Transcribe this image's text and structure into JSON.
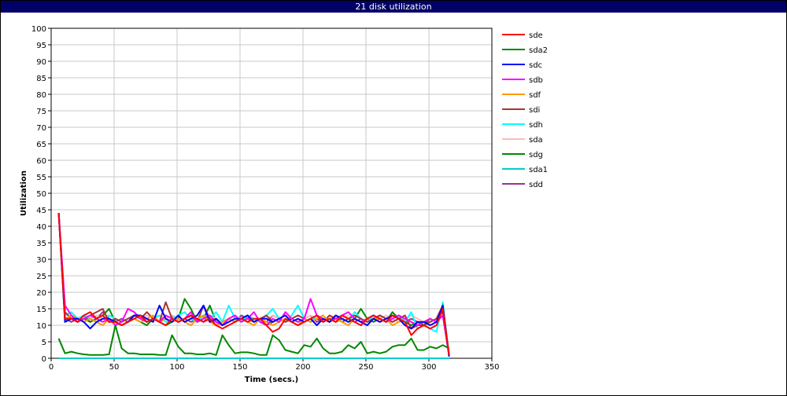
{
  "window": {
    "title": "21 disk utilization"
  },
  "chart_data": {
    "type": "line",
    "title": "21 disk utilization",
    "xlabel": "Time (secs.)",
    "ylabel": "Utilization",
    "xlim": [
      0,
      350
    ],
    "ylim": [
      0,
      100
    ],
    "xticks": [
      0,
      50,
      100,
      150,
      200,
      250,
      300,
      350
    ],
    "yticks": [
      0,
      5,
      10,
      15,
      20,
      25,
      30,
      35,
      40,
      45,
      50,
      55,
      60,
      65,
      70,
      75,
      80,
      85,
      90,
      95,
      100
    ],
    "grid": true,
    "legend": "right",
    "x": [
      6,
      11,
      16,
      21,
      26,
      31,
      36,
      41,
      46,
      51,
      56,
      61,
      66,
      71,
      76,
      81,
      86,
      91,
      96,
      101,
      106,
      111,
      116,
      121,
      126,
      131,
      136,
      141,
      146,
      151,
      156,
      161,
      166,
      171,
      176,
      181,
      186,
      191,
      196,
      201,
      206,
      211,
      216,
      221,
      226,
      231,
      236,
      241,
      246,
      251,
      256,
      261,
      266,
      271,
      276,
      281,
      286,
      291,
      296,
      301,
      306,
      311,
      316
    ],
    "series": [
      {
        "name": "sde",
        "color": "#ff0000",
        "values": [
          44,
          12,
          12,
          11,
          13,
          14,
          12,
          13,
          11,
          11,
          10,
          11,
          12,
          13,
          11,
          12,
          11,
          10,
          12,
          11,
          12,
          13,
          12,
          11,
          12,
          10,
          9,
          10,
          11,
          12,
          11,
          12,
          12,
          10,
          8,
          9,
          12,
          11,
          10,
          11,
          12,
          13,
          11,
          12,
          11,
          13,
          12,
          11,
          10,
          12,
          13,
          12,
          11,
          13,
          12,
          11,
          7,
          9,
          10,
          9,
          10,
          15,
          1
        ]
      },
      {
        "name": "sda2",
        "color": "#008800",
        "values": [
          6,
          1.5,
          2,
          1.5,
          1.2,
          1,
          1,
          1,
          1.2,
          10,
          3,
          1.5,
          1.5,
          1.2,
          1.2,
          1.2,
          1,
          1,
          7,
          3.5,
          1.5,
          1.5,
          1.2,
          1.2,
          1.5,
          1,
          7,
          4,
          1.5,
          1.8,
          1.8,
          1.5,
          1,
          1,
          7,
          5.5,
          2.5,
          2,
          1.5,
          4,
          3.5,
          6,
          3,
          1.5,
          1.5,
          2,
          4,
          3,
          5,
          1.5,
          2,
          1.5,
          2,
          3.5,
          4,
          4,
          6,
          2.5,
          2.5,
          3.5,
          3,
          4,
          3
        ]
      },
      {
        "name": "sdc",
        "color": "#0000ff",
        "values": [
          44,
          11,
          12,
          12,
          11,
          9,
          11,
          12,
          12,
          11,
          10,
          11,
          13,
          13,
          12,
          11,
          16,
          12,
          11,
          13,
          11,
          12,
          13,
          16,
          11,
          12,
          10,
          11,
          12,
          12,
          13,
          11,
          12,
          12,
          11,
          12,
          13,
          11,
          12,
          11,
          12,
          10,
          12,
          11,
          13,
          12,
          11,
          12,
          11,
          10,
          12,
          11,
          12,
          13,
          12,
          10,
          9,
          11,
          11,
          10,
          11,
          16,
          0.5
        ]
      },
      {
        "name": "sdb",
        "color": "#ff00ff",
        "values": [
          44,
          16,
          13,
          11,
          12,
          13,
          12,
          11,
          12,
          10,
          11,
          15,
          14,
          12,
          11,
          12,
          11,
          13,
          12,
          11,
          12,
          14,
          11,
          12,
          13,
          11,
          10,
          12,
          13,
          11,
          12,
          14,
          11,
          10,
          12,
          11,
          14,
          12,
          11,
          12,
          18,
          13,
          12,
          11,
          12,
          13,
          14,
          12,
          11,
          12,
          13,
          12,
          11,
          12,
          13,
          12,
          11,
          10,
          11,
          12,
          11,
          13,
          1
        ]
      },
      {
        "name": "sdf",
        "color": "#ff9900",
        "values": [
          44,
          12,
          13,
          12,
          11,
          12,
          11,
          10,
          12,
          11,
          10,
          11,
          12,
          11,
          12,
          13,
          11,
          12,
          11,
          12,
          11,
          10,
          12,
          13,
          11,
          10,
          11,
          12,
          11,
          12,
          11,
          10,
          12,
          11,
          10,
          11,
          12,
          11,
          10,
          12,
          11,
          12,
          13,
          11,
          12,
          11,
          10,
          12,
          11,
          12,
          13,
          11,
          12,
          10,
          11,
          12,
          11,
          10,
          11,
          12,
          11,
          16,
          1
        ]
      },
      {
        "name": "sdi",
        "color": "#aa3333",
        "values": [
          44,
          14,
          12,
          11,
          12,
          13,
          14,
          15,
          11,
          12,
          11,
          12,
          13,
          12,
          14,
          12,
          11,
          17,
          12,
          11,
          12,
          13,
          11,
          16,
          12,
          11,
          10,
          12,
          11,
          12,
          13,
          11,
          12,
          13,
          11,
          12,
          11,
          12,
          13,
          12,
          11,
          12,
          11,
          13,
          12,
          11,
          12,
          13,
          12,
          11,
          12,
          13,
          12,
          11,
          12,
          13,
          9,
          10,
          10,
          11,
          12,
          16,
          1
        ]
      },
      {
        "name": "sdh",
        "color": "#00ffff",
        "values": [
          44,
          13,
          14,
          12,
          13,
          12,
          11,
          12,
          13,
          12,
          11,
          12,
          13,
          12,
          11,
          12,
          13,
          11,
          12,
          13,
          14,
          12,
          11,
          13,
          12,
          14,
          11,
          16,
          12,
          11,
          13,
          12,
          11,
          13,
          15,
          12,
          11,
          13,
          16,
          12,
          11,
          13,
          12,
          11,
          13,
          12,
          11,
          14,
          12,
          11,
          13,
          12,
          11,
          12,
          13,
          11,
          14,
          9,
          10,
          9,
          8,
          17,
          1
        ]
      },
      {
        "name": "sda",
        "color": "#ffbbbb",
        "values": [
          44,
          12,
          13,
          12,
          13,
          12,
          13,
          12,
          13,
          12,
          11,
          12,
          13,
          12,
          13,
          12,
          13,
          12,
          13,
          12,
          11,
          12,
          13,
          12,
          13,
          12,
          11,
          12,
          13,
          12,
          13,
          12,
          11,
          12,
          13,
          12,
          13,
          12,
          11,
          12,
          13,
          12,
          11,
          12,
          13,
          12,
          13,
          12,
          11,
          12,
          13,
          12,
          13,
          12,
          11,
          12,
          13,
          12,
          11,
          12,
          11,
          13,
          1
        ]
      },
      {
        "name": "sdg",
        "color": "#008800",
        "values": [
          44,
          11,
          12,
          11,
          12,
          11,
          12,
          13,
          15,
          11,
          10,
          11,
          12,
          11,
          10,
          12,
          11,
          10,
          11,
          12,
          18,
          15,
          11,
          12,
          16,
          11,
          10,
          12,
          11,
          12,
          11,
          12,
          11,
          10,
          11,
          12,
          11,
          12,
          11,
          12,
          11,
          12,
          11,
          12,
          11,
          12,
          11,
          12,
          15,
          12,
          11,
          12,
          11,
          14,
          12,
          11,
          10,
          11,
          10,
          12,
          11,
          13,
          1
        ]
      },
      {
        "name": "sda1",
        "color": "#00cccc",
        "values": [
          0,
          0,
          0,
          0,
          0,
          0,
          0,
          0,
          0,
          0,
          0,
          0,
          0,
          0,
          0,
          0,
          0,
          0,
          0,
          0,
          0,
          0,
          0,
          0,
          0,
          0,
          0,
          0,
          0,
          0,
          0,
          0,
          0,
          0,
          0,
          0,
          0,
          0,
          0,
          0,
          0,
          0,
          0,
          0,
          0,
          0,
          0,
          0,
          0,
          0,
          0,
          0,
          0,
          0,
          0,
          0,
          0,
          0,
          0,
          0,
          0,
          0,
          0
        ]
      },
      {
        "name": "sdd",
        "color": "#993399",
        "values": [
          44,
          12,
          11,
          12,
          13,
          11,
          12,
          14,
          12,
          11,
          12,
          11,
          13,
          12,
          11,
          12,
          11,
          12,
          13,
          11,
          12,
          11,
          12,
          11,
          13,
          12,
          11,
          12,
          11,
          13,
          12,
          11,
          12,
          11,
          13,
          12,
          11,
          12,
          11,
          12,
          13,
          11,
          12,
          11,
          12,
          13,
          12,
          11,
          12,
          11,
          12,
          13,
          12,
          11,
          12,
          11,
          12,
          11,
          10,
          11,
          12,
          14,
          1
        ]
      }
    ]
  }
}
